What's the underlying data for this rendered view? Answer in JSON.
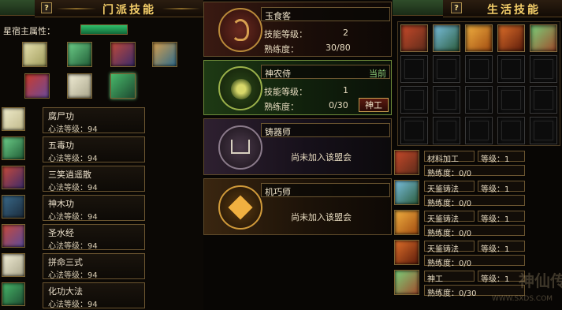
{
  "left_panel": {
    "title": "门派技能",
    "help_label": "?",
    "attribute_label": "星宿主属性：",
    "martial_skills": [
      {
        "name": "腐尸功",
        "level": "心法等级：94"
      },
      {
        "name": "五毒功",
        "level": "心法等级：94"
      },
      {
        "name": "三笑逍遥散",
        "level": "心法等级：94"
      },
      {
        "name": "神木功",
        "level": "心法等级：94"
      },
      {
        "name": "圣水经",
        "level": "心法等级：94"
      },
      {
        "name": "拼命三式",
        "level": "心法等级：94"
      },
      {
        "name": "化功大法",
        "level": "心法等级：94"
      }
    ]
  },
  "professions": {
    "cooking": {
      "name": "玉食客",
      "skill_level_label": "技能等级：",
      "skill_level_value": "2",
      "proficiency_label": "熟练度：",
      "proficiency_value": "30/80"
    },
    "medicine": {
      "name": "神农侍",
      "badge": "当前",
      "skill_level_label": "技能等级：",
      "skill_level_value": "1",
      "proficiency_label": "熟练度：",
      "proficiency_value": "0/30",
      "button": "神工"
    },
    "forging": {
      "name": "铸器师",
      "status": "尚未加入该盟会"
    },
    "crafting": {
      "name": "机巧师",
      "status": "尚未加入该盟会"
    }
  },
  "right_panel": {
    "title": "生活技能",
    "help_label": "?",
    "skill_rows": [
      {
        "name": "材料加工",
        "level": "等级：1",
        "proficiency": "熟练度：0/0"
      },
      {
        "name": "天鉴铸法",
        "level": "等级：1",
        "proficiency": "熟练度：0/0"
      },
      {
        "name": "天鉴铸法",
        "level": "等级：1",
        "proficiency": "熟练度：0/0"
      },
      {
        "name": "天鉴铸法",
        "level": "等级：1",
        "proficiency": "熟练度：0/0"
      },
      {
        "name": "神工",
        "level": "等级：1",
        "proficiency": "熟练度：0/30"
      }
    ]
  },
  "watermark": {
    "text": "神仙传",
    "url": "WWW.SXDS.COM"
  },
  "colors": {
    "gold_title": "#f5cf6a",
    "badge_green": "#8fd07a",
    "panel_border": "#6b5530",
    "attribute_bar": "#1f8f4a"
  },
  "icons": [
    "help-icon",
    "skill-book-icon",
    "cooking-emblem-icon",
    "medicine-emblem-icon",
    "forging-emblem-icon",
    "crafting-emblem-icon",
    "empty-slot-icon"
  ]
}
